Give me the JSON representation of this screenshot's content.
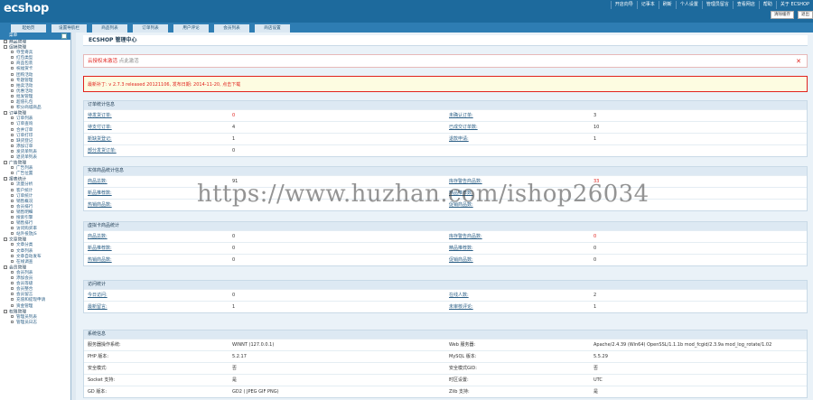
{
  "header": {
    "logo": "ecshop",
    "links": [
      "开店向导",
      "记事本",
      "刷新",
      "个人设置",
      "管理员留言",
      "查看网店",
      "帮助",
      "关于 ECSHOP"
    ],
    "buttons": [
      "清除缓存",
      "退出"
    ]
  },
  "tabs": [
    "起始页",
    "设置导航栏",
    "商品列表",
    "订单列表",
    "用户评论",
    "会员列表",
    "商店设置"
  ],
  "sidebar": {
    "title": "菜单",
    "menu": [
      {
        "t": "g",
        "label": "商品管理"
      },
      {
        "t": "g",
        "label": "促销管理"
      },
      {
        "t": "i",
        "label": "夺宝奇兵"
      },
      {
        "t": "i",
        "label": "红包类型"
      },
      {
        "t": "i",
        "label": "商品包装"
      },
      {
        "t": "i",
        "label": "祝福贺卡"
      },
      {
        "t": "i",
        "label": "团购活动"
      },
      {
        "t": "i",
        "label": "专题管理"
      },
      {
        "t": "i",
        "label": "拍卖活动"
      },
      {
        "t": "i",
        "label": "优惠活动"
      },
      {
        "t": "i",
        "label": "批发管理"
      },
      {
        "t": "i",
        "label": "超值礼包"
      },
      {
        "t": "i",
        "label": "积分商城商品"
      },
      {
        "t": "g",
        "label": "订单管理"
      },
      {
        "t": "i",
        "label": "订单列表"
      },
      {
        "t": "i",
        "label": "订单查询"
      },
      {
        "t": "i",
        "label": "合并订单"
      },
      {
        "t": "i",
        "label": "订单打印"
      },
      {
        "t": "i",
        "label": "缺货登记"
      },
      {
        "t": "i",
        "label": "添加订单"
      },
      {
        "t": "i",
        "label": "发货单列表"
      },
      {
        "t": "i",
        "label": "退货单列表"
      },
      {
        "t": "g",
        "label": "广告管理"
      },
      {
        "t": "i",
        "label": "广告列表"
      },
      {
        "t": "i",
        "label": "广告位置"
      },
      {
        "t": "g",
        "label": "报表统计"
      },
      {
        "t": "i",
        "label": "流量分析"
      },
      {
        "t": "i",
        "label": "客户统计"
      },
      {
        "t": "i",
        "label": "订单统计"
      },
      {
        "t": "i",
        "label": "销售概况"
      },
      {
        "t": "i",
        "label": "会员排行"
      },
      {
        "t": "i",
        "label": "销售明细"
      },
      {
        "t": "i",
        "label": "搜索引擎"
      },
      {
        "t": "i",
        "label": "销售排行"
      },
      {
        "t": "i",
        "label": "访问购买率"
      },
      {
        "t": "i",
        "label": "站外投放JS"
      },
      {
        "t": "g",
        "label": "文章管理"
      },
      {
        "t": "i",
        "label": "文章分类"
      },
      {
        "t": "i",
        "label": "文章列表"
      },
      {
        "t": "i",
        "label": "文章自动发布"
      },
      {
        "t": "i",
        "label": "在线调查"
      },
      {
        "t": "g",
        "label": "会员管理"
      },
      {
        "t": "i",
        "label": "会员列表"
      },
      {
        "t": "i",
        "label": "添加会员"
      },
      {
        "t": "i",
        "label": "会员等级"
      },
      {
        "t": "i",
        "label": "会员整合"
      },
      {
        "t": "i",
        "label": "会员留言"
      },
      {
        "t": "i",
        "label": "充值和提现申请"
      },
      {
        "t": "i",
        "label": "资金管理"
      },
      {
        "t": "g",
        "label": "权限管理"
      },
      {
        "t": "i",
        "label": "管理员列表"
      },
      {
        "t": "i",
        "label": "管理员日志"
      }
    ]
  },
  "main": {
    "title": "ECSHOP 管理中心",
    "alert_cloud": "云授权未激活",
    "alert_cloud_sub": "点此激活",
    "alert_update": "最新补丁: v 2.7.3 released 20121106, 发布日期: 2014-11-20, 点击下载",
    "sections": [
      {
        "title": "订单统计信息",
        "rows": [
          [
            "待发货订单:",
            "0",
            "未确认订单:",
            "3"
          ],
          [
            "待支付订单:",
            "4",
            "已成交订单数:",
            "10"
          ],
          [
            "新缺货登记:",
            "1",
            "退款申请:",
            "1"
          ],
          [
            "部分发货订单:",
            "0",
            "",
            ""
          ]
        ]
      },
      {
        "title": "实体商品统计信息",
        "rows": [
          [
            "商品总数:",
            "91",
            "库存警告商品数:",
            "33"
          ],
          [
            "新品推荐数:",
            "",
            "精品推荐数:",
            ""
          ],
          [
            "热销商品数:",
            "",
            "促销商品数:",
            ""
          ]
        ]
      },
      {
        "title": "虚拟卡商品统计",
        "rows": [
          [
            "商品总数:",
            "0",
            "库存警告商品数:",
            "0"
          ],
          [
            "新品推荐数:",
            "0",
            "精品推荐数:",
            "0"
          ],
          [
            "热销商品数:",
            "0",
            "促销商品数:",
            "0"
          ]
        ]
      },
      {
        "title": "访问统计",
        "rows": [
          [
            "今日访问:",
            "0",
            "在线人数:",
            "2"
          ],
          [
            "最新留言:",
            "1",
            "未审核评论:",
            "1"
          ]
        ]
      },
      {
        "title": "系统信息",
        "rows": [
          [
            "服务器操作系统:",
            "WINNT (127.0.0.1)",
            "Web 服务器:",
            "Apache/2.4.39 (Win64) OpenSSL/1.1.1b mod_fcgid/2.3.9a mod_log_rotate/1.02"
          ],
          [
            "PHP 版本:",
            "5.2.17",
            "MySQL 版本:",
            "5.5.29"
          ],
          [
            "安全模式:",
            "否",
            "安全模式GID:",
            "否"
          ],
          [
            "Socket 支持:",
            "是",
            "时区设置:",
            "UTC"
          ],
          [
            "GD 版本:",
            "GD2 ( JPEG GIF PNG)",
            "Zlib 支持:",
            "是"
          ]
        ]
      }
    ]
  },
  "watermark": "https://www.huzhan.com/ishop26034"
}
